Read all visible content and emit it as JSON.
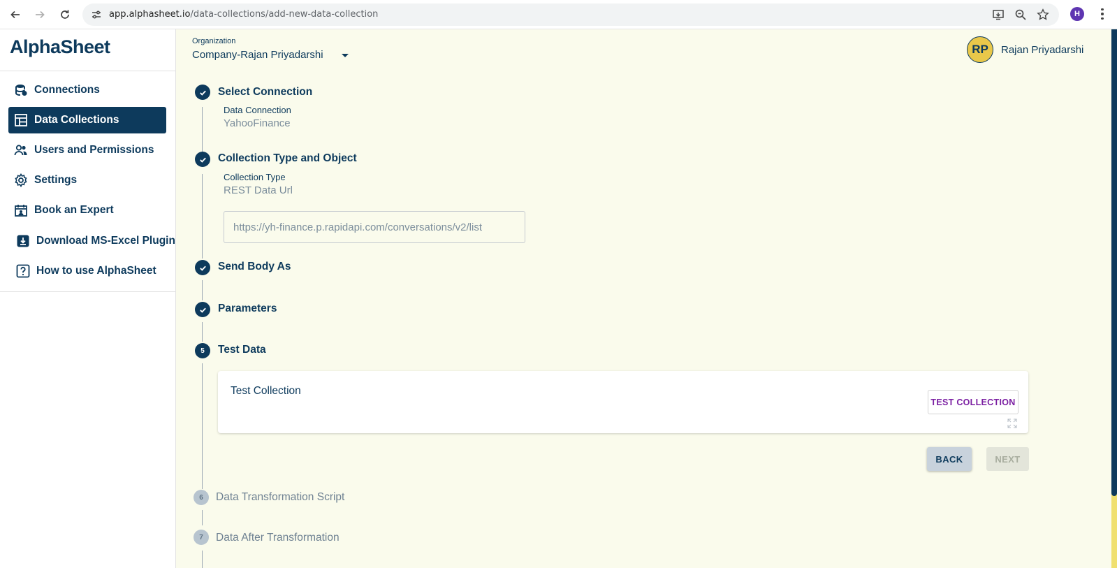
{
  "browser": {
    "url_host": "app.alphasheet.io",
    "url_path": "/data-collections/add-new-data-collection",
    "profile_initial": "H"
  },
  "sidebar": {
    "logo": "AlphaSheet",
    "items": [
      {
        "label": "Connections",
        "icon": "database-icon",
        "active": false
      },
      {
        "label": "Data Collections",
        "icon": "table-icon",
        "active": true
      },
      {
        "label": "Users and Permissions",
        "icon": "users-icon",
        "active": false
      },
      {
        "label": "Settings",
        "icon": "gear-icon",
        "active": false
      },
      {
        "label": "Book an Expert",
        "icon": "calendar-icon",
        "active": false
      },
      {
        "label": "Download MS-Excel Plugin",
        "icon": "download-icon",
        "active": false
      },
      {
        "label": "How to use AlphaSheet",
        "icon": "help-icon",
        "active": false
      }
    ]
  },
  "header": {
    "org_label": "Organization",
    "org_value": "Company-Rajan Priyadarshi",
    "avatar_initials": "RP",
    "user_name": "Rajan Priyadarshi"
  },
  "steps": [
    {
      "title": "Select Connection",
      "status": "done",
      "sub_label": "Data Connection",
      "sub_value": "YahooFinance"
    },
    {
      "title": "Collection Type and Object",
      "status": "done",
      "sub_label": "Collection Type",
      "sub_value": "REST Data Url",
      "input_value": "https://yh-finance.p.rapidapi.com/conversations/v2/list"
    },
    {
      "title": "Send Body As",
      "status": "done"
    },
    {
      "title": "Parameters",
      "status": "done"
    },
    {
      "title": "Test Data",
      "status": "active",
      "number": "5",
      "card_title": "Test Collection",
      "test_button": "TEST COLLECTION",
      "back_button": "BACK",
      "next_button": "NEXT"
    },
    {
      "title": "Data Transformation Script",
      "status": "pending",
      "number": "6"
    },
    {
      "title": "Data After Transformation",
      "status": "pending",
      "number": "7"
    }
  ],
  "colors": {
    "primary": "#0d3a5c",
    "background": "#fafbec",
    "accent_purple": "#7b1fa2",
    "avatar_yellow": "#e9c84a"
  }
}
